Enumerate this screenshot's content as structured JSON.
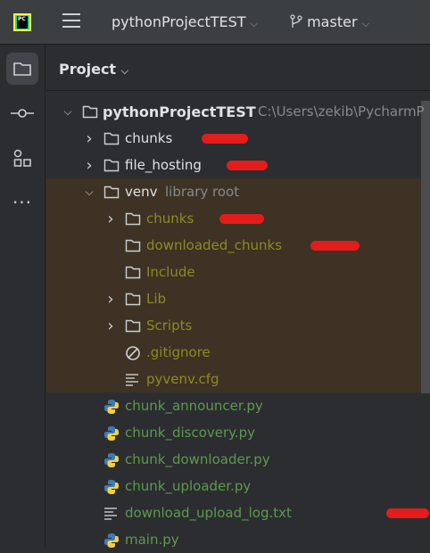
{
  "topbar": {
    "project": "pythonProjectTEST",
    "branch": "master",
    "logo": "PC"
  },
  "panel": {
    "title": "Project"
  },
  "tree": {
    "root": {
      "name": "pythonProjectTEST",
      "path": "C:\\Users\\zekib\\PycharmP"
    },
    "items": [
      {
        "name": "chunks"
      },
      {
        "name": "file_hosting"
      },
      {
        "name": "venv",
        "hint": "library root"
      },
      {
        "name": "chunks"
      },
      {
        "name": "downloaded_chunks"
      },
      {
        "name": "Include"
      },
      {
        "name": "Lib"
      },
      {
        "name": "Scripts"
      },
      {
        "name": ".gitignore"
      },
      {
        "name": "pyvenv.cfg"
      },
      {
        "name": "chunk_announcer.py"
      },
      {
        "name": "chunk_discovery.py"
      },
      {
        "name": "chunk_downloader.py"
      },
      {
        "name": "chunk_uploader.py"
      },
      {
        "name": "download_upload_log.txt"
      },
      {
        "name": "main.py"
      }
    ]
  },
  "colors": {
    "green": "#5e9a4f",
    "olive": "#8f8a26",
    "venv_bg": "#3d3223",
    "redaction": "#e31c1c"
  }
}
